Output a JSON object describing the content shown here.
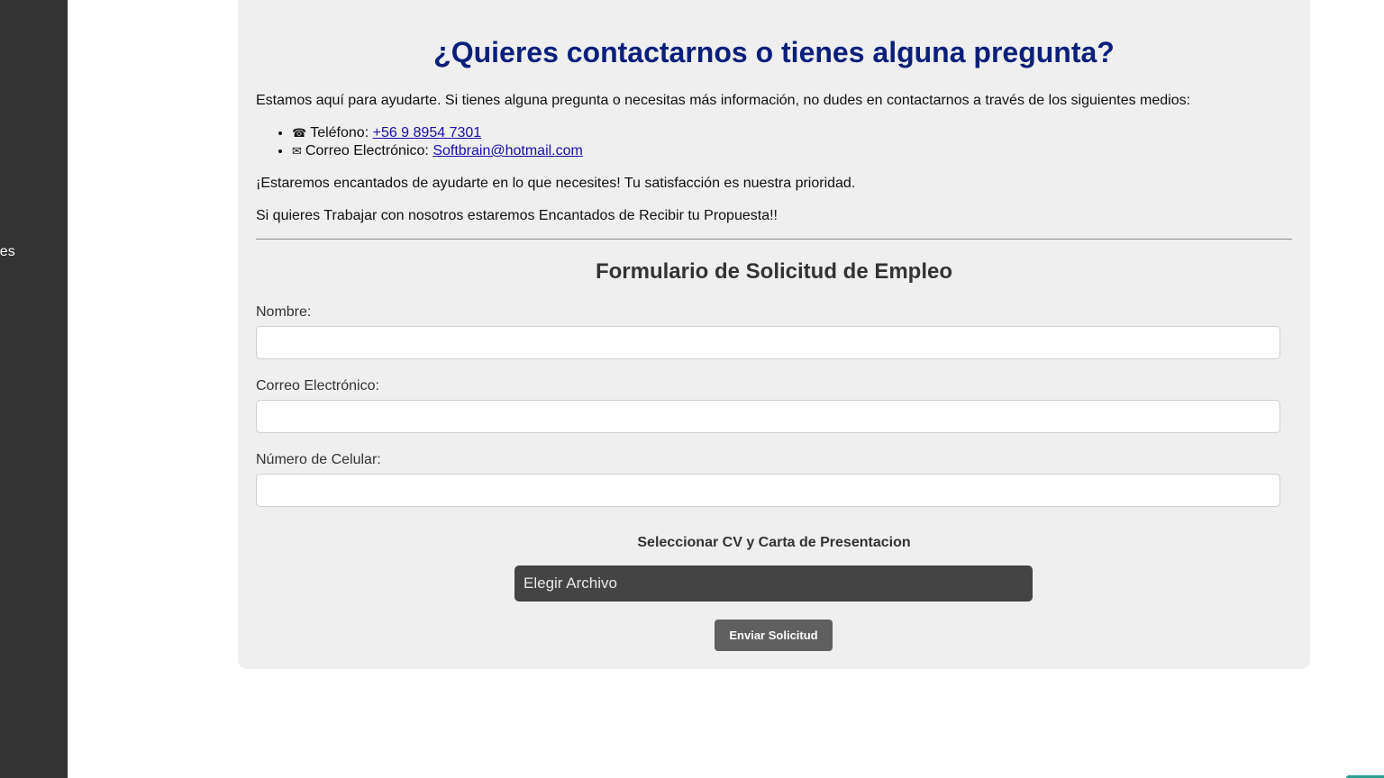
{
  "sidebar": {
    "items": [
      {
        "label": "ones"
      }
    ]
  },
  "contact": {
    "title": "¿Quieres contactarnos o tienes alguna pregunta?",
    "intro": "Estamos aquí para ayudarte. Si tienes alguna pregunta o necesitas más información, no dudes en contactarnos a través de los siguientes medios:",
    "phone": {
      "icon": "phone-icon",
      "label": "Teléfono:",
      "value": "+56 9 8954 7301"
    },
    "email": {
      "icon": "mailbox-icon",
      "label": "Correo Electrónico:",
      "value": "Softbrain@hotmail.com"
    },
    "closing": "¡Estaremos encantados de ayudarte en lo que necesites! Tu satisfacción es nuestra prioridad.",
    "work": "Si quieres Trabajar con nosotros estaremos Encantados de Recibir tu Propuesta!!"
  },
  "form": {
    "title": "Formulario de Solicitud de Empleo",
    "fields": [
      {
        "label": "Nombre:",
        "value": ""
      },
      {
        "label": "Correo Electrónico:",
        "value": ""
      },
      {
        "label": "Número de Celular:",
        "value": ""
      }
    ],
    "file_label": "Seleccionar CV y Carta de Presentacion",
    "file_button": "Elegir Archivo",
    "submit": "Enviar Solicitud"
  },
  "colors": {
    "sidebar_bg": "#333333",
    "title_color": "#0a1f7a",
    "card_bg": "#efefef",
    "link_color": "#1a0dab",
    "button_bg": "#5f5f5f"
  }
}
